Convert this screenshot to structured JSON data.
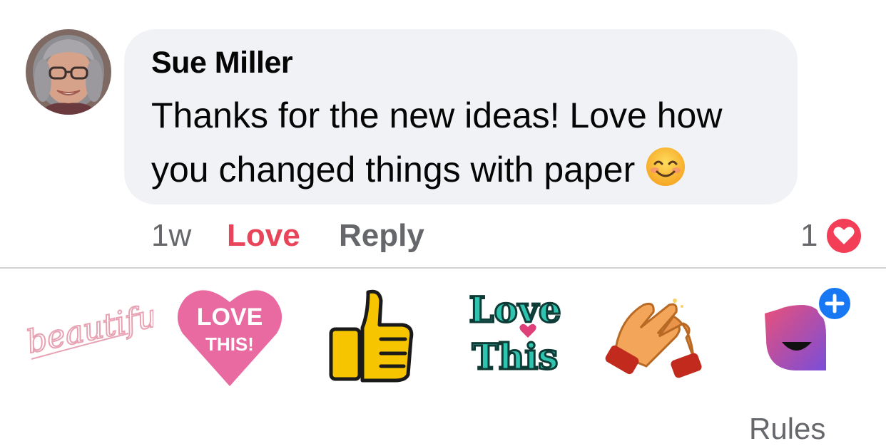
{
  "comment": {
    "author": "Sue Miller",
    "text_line1": "Thanks for the new ideas!  Love how",
    "text_line2": "you changed things with paper",
    "emoji": "smiling-face-with-smiling-eyes"
  },
  "actions": {
    "time": "1w",
    "love_label": "Love",
    "reply_label": "Reply",
    "reaction_count": "1",
    "reaction_type": "heart"
  },
  "stickers": {
    "items": [
      {
        "name": "beautiful",
        "text": "beautiful"
      },
      {
        "name": "love-this-heart",
        "text_top": "LOVE",
        "text_bottom": "THIS!"
      },
      {
        "name": "thumbs-up"
      },
      {
        "name": "love-this-text",
        "text_top": "Love",
        "text_bottom": "This"
      },
      {
        "name": "clapping-hands"
      },
      {
        "name": "more-stickers"
      }
    ]
  },
  "footer": {
    "rules_label": "Rules"
  },
  "colors": {
    "bubble": "#f0f2f5",
    "love": "#e8455a",
    "muted": "#65676b",
    "heart_badge": "#f33e58",
    "sticker_pink": "#e96aa0",
    "sticker_teal": "#2ec4b0",
    "plus_badge": "#1877f2"
  }
}
